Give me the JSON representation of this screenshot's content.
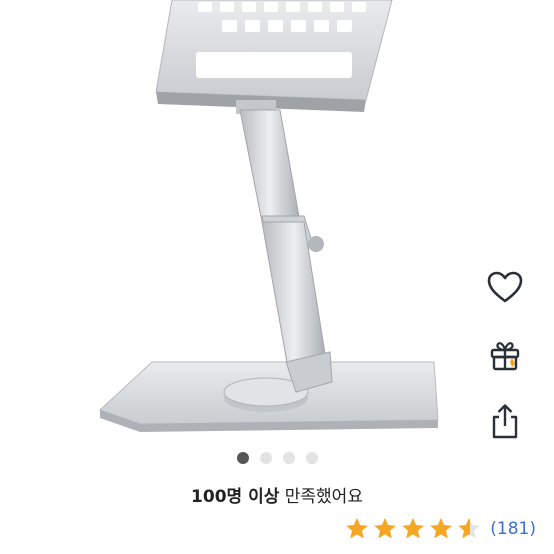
{
  "product": {
    "image_alt": "알루미늄 노트북 거치대",
    "carousel": {
      "total": 4,
      "active": 1
    }
  },
  "actions": [
    {
      "name": "wishlist",
      "icon": "heart-icon"
    },
    {
      "name": "gift",
      "icon": "gift-icon"
    },
    {
      "name": "share",
      "icon": "share-icon"
    }
  ],
  "satisfaction": {
    "bold": "100명 이상",
    "rest": " 만족했어요"
  },
  "rating": {
    "stars": 4.5,
    "count": "(181)",
    "star_color": "#f5a623",
    "count_color": "#3a6fd8"
  }
}
